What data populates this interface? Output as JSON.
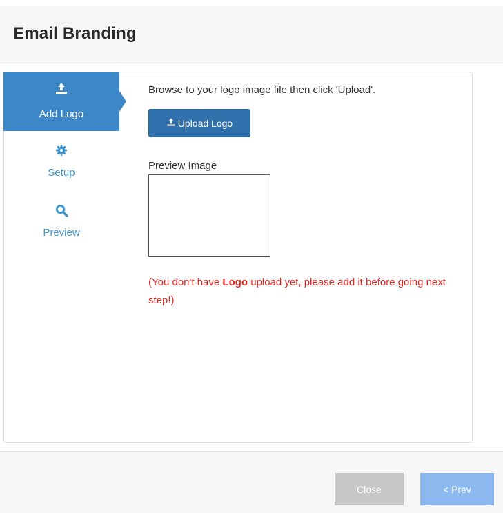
{
  "header": {
    "title": "Email Branding"
  },
  "steps": [
    {
      "label": "Add Logo",
      "icon": "upload-icon",
      "active": true
    },
    {
      "label": "Setup",
      "icon": "gear-icon",
      "active": false
    },
    {
      "label": "Preview",
      "icon": "search-icon",
      "active": false
    }
  ],
  "main": {
    "instruction": "Browse to your logo image file then click 'Upload'.",
    "upload_button_label": "Upload Logo",
    "preview_label": "Preview Image",
    "warning_prefix": "(You don't have ",
    "warning_bold": "Logo",
    "warning_suffix": " upload yet, please add it before going next step!)"
  },
  "footer": {
    "close_label": "Close",
    "prev_label": "< Prev"
  },
  "colors": {
    "active_step": "#3c87c8",
    "inactive_step_text": "#3f97d2",
    "primary_button": "#2f6fac",
    "warning_text": "#e8221c",
    "close_button": "#c6c6c6",
    "prev_button": "#8bb8ee"
  }
}
